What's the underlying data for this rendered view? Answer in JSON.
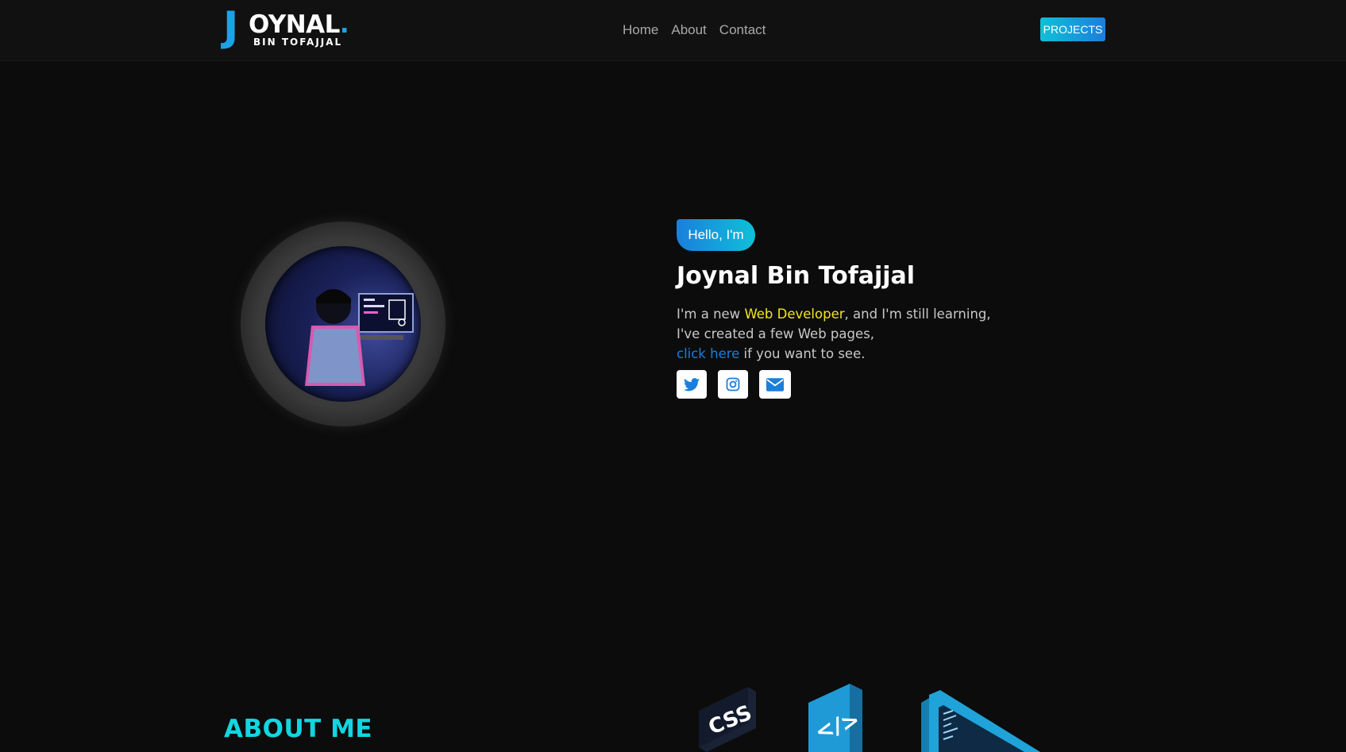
{
  "brand": {
    "logo_letter": "J",
    "logo_main": "OYNAL",
    "logo_dot": ".",
    "logo_sub": "BIN TOFAJJAL"
  },
  "nav": {
    "links": [
      "Home",
      "About",
      "Contact"
    ],
    "projects_label": "PROJECTS"
  },
  "hero": {
    "greeting": "Hello, I'm",
    "name": "Joynal Bin Tofajjal",
    "intro_prefix": "I'm a new ",
    "intro_highlight": "Web Developer",
    "intro_suffix": ", and I'm still learning,",
    "line2": "I've created a few Web pages,",
    "link_text": "click here",
    "link_suffix": " if you want to see.",
    "socials": [
      {
        "icon": "twitter-icon"
      },
      {
        "icon": "instagram-icon"
      },
      {
        "icon": "envelope-icon"
      }
    ]
  },
  "about": {
    "title": "ABOUT ME",
    "art_labels": [
      "CSS",
      "</>"
    ]
  },
  "colors": {
    "accent_cyan": "#12d6e0",
    "accent_blue": "#1a7fdc",
    "highlight_yellow": "#f1e71e",
    "background": "#0c0c0c"
  }
}
